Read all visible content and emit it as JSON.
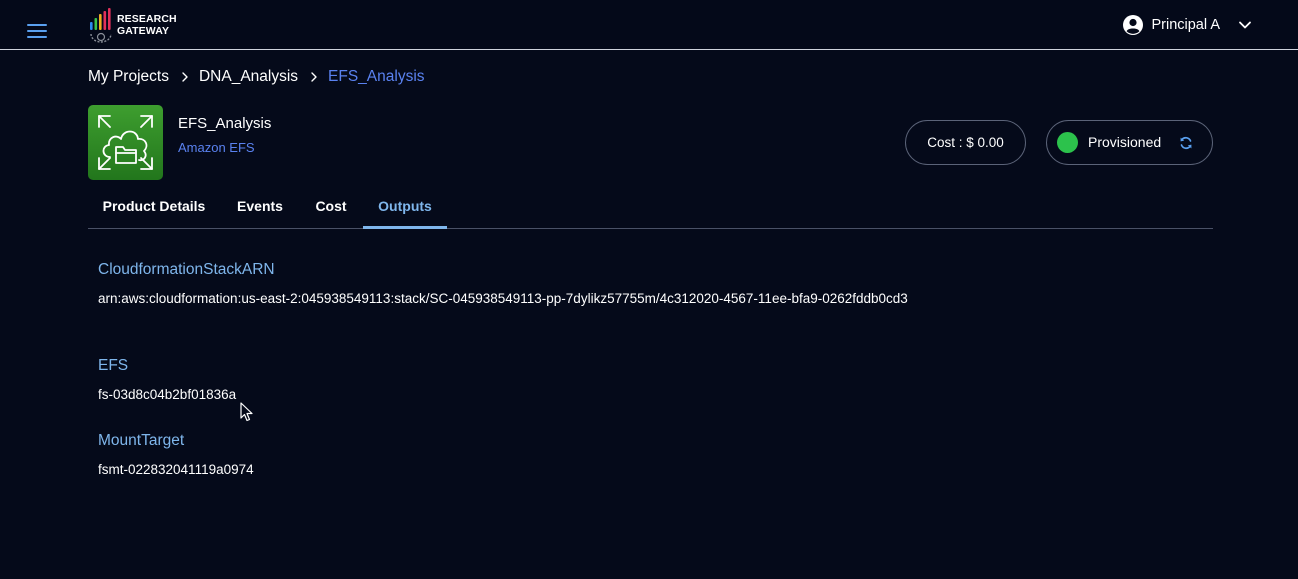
{
  "header": {
    "logo_line1": "RESEARCH",
    "logo_line2": "GATEWAY",
    "user_name": "Principal A"
  },
  "breadcrumb": {
    "items": [
      "My Projects",
      "DNA_Analysis",
      "EFS_Analysis"
    ]
  },
  "product": {
    "name": "EFS_Analysis",
    "type": "Amazon EFS",
    "cost": "Cost : $ 0.00",
    "status": "Provisioned"
  },
  "tabs": [
    "Product Details",
    "Events",
    "Cost",
    "Outputs"
  ],
  "outputs": [
    {
      "key": "CloudformationStackARN",
      "value": "arn:aws:cloudformation:us-east-2:045938549113:stack/SC-045938549113-pp-7dylikz57755m/4c312020-4567-11ee-bfa9-0262fddb0cd3"
    },
    {
      "key": "EFS",
      "value": "fs-03d8c04b2bf01836a"
    },
    {
      "key": "MountTarget",
      "value": "fsmt-022832041119a0974"
    }
  ],
  "colors": {
    "background": "#050a1a",
    "accent_link": "#5a82f0",
    "accent_tab": "#7fb6ec",
    "status_green": "#2cc24c",
    "product_icon_green": "#3e9e2f"
  },
  "icons": [
    "hamburger-menu-icon",
    "research-gateway-logo",
    "user-avatar-icon",
    "chevron-down-icon",
    "chevron-right-icon",
    "efs-cloud-folder-icon",
    "refresh-icon",
    "mouse-cursor-icon"
  ]
}
